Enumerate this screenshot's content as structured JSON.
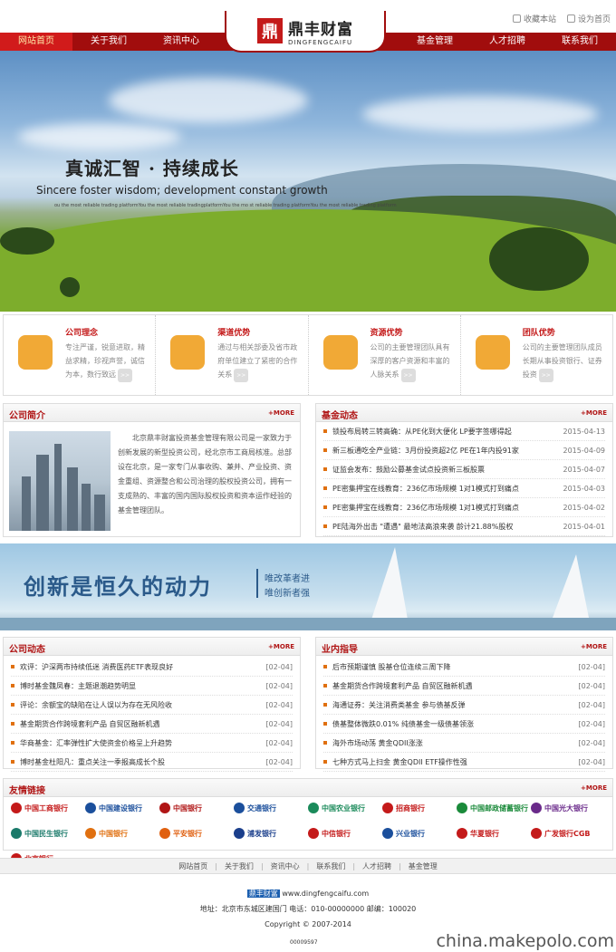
{
  "toplinks": {
    "favorite": "收藏本站",
    "homepage": "设为首页"
  },
  "brand": {
    "cn": "鼎丰财富",
    "en": "DINGFENGCAIFU",
    "mark": "鼎"
  },
  "nav": [
    "网站首页",
    "关于我们",
    "资讯中心",
    "基金管理",
    "人才招聘",
    "联系我们"
  ],
  "banner": {
    "headline": "真诚汇智 · 持续成长",
    "subline": "Sincere foster wisdom; development constant growth",
    "small": "ou the most reliable trading platformYou the most reliable tradingplatformYou the mo st reliable trading platformYou the most reliable trading platform"
  },
  "features": [
    {
      "title": "公司理念",
      "desc": "专注严谨，锐意进取，精益求精，珍视声誉，诚信为本，数行致远",
      "icon": "shield-icon"
    },
    {
      "title": "渠道优势",
      "desc": "通过与相关部委及省市政府单位建立了紧密的合作关系",
      "icon": "money-bag-icon"
    },
    {
      "title": "资源优势",
      "desc": "公司的主要管理团队具有深厚的客户资源和丰富的人脉关系",
      "icon": "chart-icon"
    },
    {
      "title": "团队优势",
      "desc": "公司的主要管理团队成员长期从事投资银行、证券投资",
      "icon": "gear-icon"
    }
  ],
  "more_label": "+MORE",
  "intro": {
    "title": "公司简介",
    "text": "北京鼎丰财富投资基金管理有限公司是一家致力于创新发展的新型投资公司，经北京市工商局核准。总部设在北京，是一家专门从事收购、兼并、产业投资、资金重组、资源整合和公司治理的股权投资公司，拥有一支成熟的、丰富的国内国际股权投资和资本运作经验的基金管理团队。"
  },
  "fund_news": {
    "title": "基金动态",
    "items": [
      {
        "text": "锁投布局转三转高确：从PE化到大便化 LP要字签哪得起",
        "date": "2015-04-13"
      },
      {
        "text": "新三板通吃全产业链：3月份投资超2亿 PE在1年内投91家",
        "date": "2015-04-09"
      },
      {
        "text": "证监会发布：鼓励公募基金试点投资新三板股票",
        "date": "2015-04-07"
      },
      {
        "text": "PE密集押宝在线教育：236亿市场规模 1对1模式打到痛点",
        "date": "2015-04-03"
      },
      {
        "text": "PE密集押宝在线教育：236亿市场规模 1对1模式打到痛点",
        "date": "2015-04-02"
      },
      {
        "text": "PE陆海外出击 \"遭遇\" 最地法高浪来袭 龄计21.88%股权",
        "date": "2015-04-01"
      }
    ]
  },
  "banner2": {
    "big": "创新是恒久的动力",
    "s1": "唯改革者进",
    "s2": "唯创新者强"
  },
  "company_news": {
    "title": "公司动态",
    "items": [
      {
        "text": "欢评：沪深两市持续低迷 消费医药ETF表现良好",
        "date": "[02-04]"
      },
      {
        "text": "博时基金魏凤春：主题退潮趋势明显",
        "date": "[02-04]"
      },
      {
        "text": "评论：余额宝的缺陷在让人误以为存在无风险收",
        "date": "[02-04]"
      },
      {
        "text": "基金期货合作跨境套利产品 自贸区融新机遇",
        "date": "[02-04]"
      },
      {
        "text": "华商基金：汇率弹性扩大使资金价格呈上升趋势",
        "date": "[02-04]"
      },
      {
        "text": "博时基金杜阳凡：重点关注一季报高成长个股",
        "date": "[02-04]"
      }
    ]
  },
  "industry_news": {
    "title": "业内指导",
    "items": [
      {
        "text": "后市预期谨慎 股基仓位连续三周下降",
        "date": "[02-04]"
      },
      {
        "text": "基金期货合作跨境套利产品 自贸区融新机遇",
        "date": "[02-04]"
      },
      {
        "text": "海通证券：关注消费类基金 参与债基反弹",
        "date": "[02-04]"
      },
      {
        "text": "债基整体微跌0.01% 纯债基金一级债基领涨",
        "date": "[02-04]"
      },
      {
        "text": "海外市场动荡 黄金QDII涨涨",
        "date": "[02-04]"
      },
      {
        "text": "七种方式马上扫金 黄金QDII ETF操作性强",
        "date": "[02-04]"
      }
    ]
  },
  "links": {
    "title": "友情链接",
    "items": [
      {
        "name": "中国工商银行",
        "color": "#c41a1a"
      },
      {
        "name": "中国建设银行",
        "color": "#1b4f9c"
      },
      {
        "name": "中国银行",
        "color": "#b01515"
      },
      {
        "name": "交通银行",
        "color": "#1b4f9c"
      },
      {
        "name": "中国农业银行",
        "color": "#1a8a5a"
      },
      {
        "name": "招商银行",
        "color": "#c41a1a"
      },
      {
        "name": "中国邮政储蓄银行",
        "color": "#1a8a3a"
      },
      {
        "name": "中国光大银行",
        "color": "#6a2a8a"
      },
      {
        "name": "中国民生银行",
        "color": "#1a7a6a"
      },
      {
        "name": "中国银行",
        "color": "#e07010"
      },
      {
        "name": "平安银行",
        "color": "#e06010"
      },
      {
        "name": "浦发银行",
        "color": "#1b3f8c"
      },
      {
        "name": "中信银行",
        "color": "#c41a1a"
      },
      {
        "name": "兴业银行",
        "color": "#1b4f9c"
      },
      {
        "name": "华夏银行",
        "color": "#c41a1a"
      },
      {
        "name": "广发银行CGB",
        "color": "#c41a1a"
      },
      {
        "name": "北京银行",
        "color": "#c41a1a"
      }
    ]
  },
  "footer": {
    "nav": [
      "网站首页",
      "关于我们",
      "资讯中心",
      "联系我们",
      "人才招聘",
      "基金管理"
    ],
    "logo": "鼎丰财富",
    "url": "www.dingfengcaifu.com",
    "address": "地址：北京市东城区建国门  电话：010-00000000  邮编：100020",
    "copyright": "Copyright © 2007-2014",
    "counter": "00009597"
  },
  "watermark": "china.makepolo.com"
}
